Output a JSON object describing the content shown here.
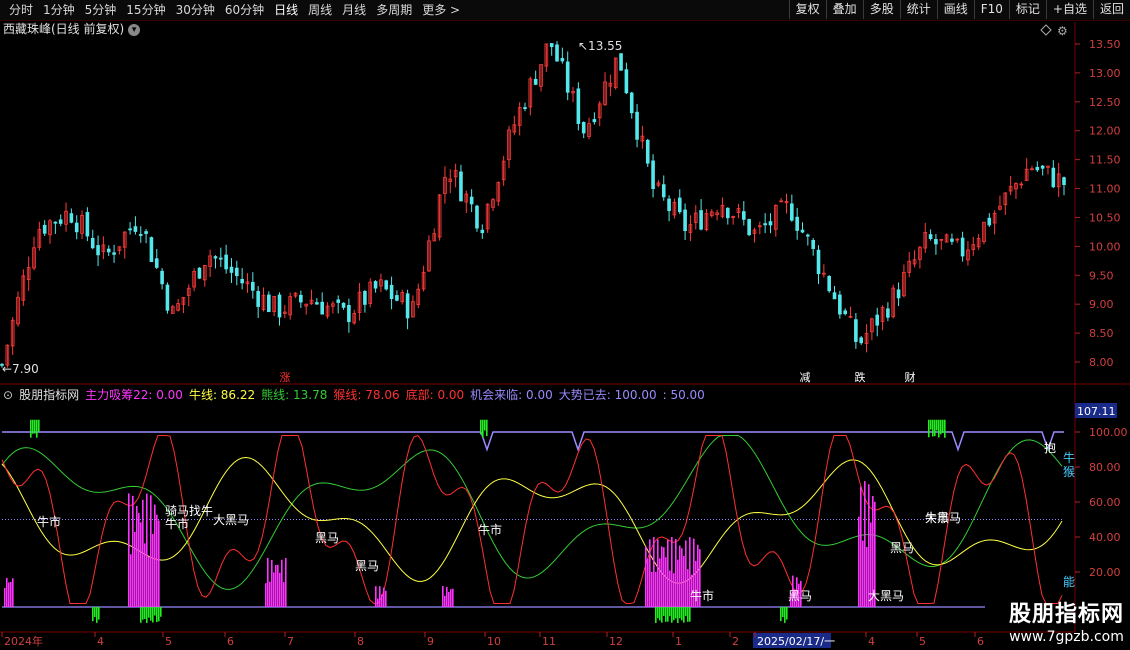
{
  "toolbar": {
    "periods": [
      "分时",
      "1分钟",
      "5分钟",
      "15分钟",
      "30分钟",
      "60分钟",
      "日线",
      "周线",
      "月线",
      "多周期",
      "更多 >"
    ],
    "active_period": "日线",
    "tools": [
      "复权",
      "叠加",
      "多股",
      "统计",
      "画线",
      "F10",
      "标记",
      "+自选",
      "返回"
    ]
  },
  "stock": {
    "title": "西藏珠峰(日线 前复权)"
  },
  "price_axis": {
    "ticks": [
      "13.55",
      "13.00",
      "12.50",
      "12.00",
      "11.50",
      "11.00",
      "10.50",
      "10.00",
      "9.50",
      "9.00",
      "8.50",
      "8.00"
    ]
  },
  "price_marks": {
    "high": "13.55",
    "low": "←7.90"
  },
  "event_markers": [
    {
      "text": "涨",
      "color": "#ff3030"
    },
    {
      "text": "减",
      "color": "#ffffff"
    },
    {
      "text": "跌",
      "color": "#ffffff"
    },
    {
      "text": "财",
      "color": "#ffffff"
    }
  ],
  "indicator": {
    "name": "股朋指标网",
    "items": [
      {
        "label": "主力吸筹22: 0.00",
        "color": "#ff33ff"
      },
      {
        "label": "牛线: 86.22",
        "color": "#ffff44"
      },
      {
        "label": "熊线: 13.78",
        "color": "#33cc33"
      },
      {
        "label": "猴线: 78.06",
        "color": "#ff3030"
      },
      {
        "label": "底部: 0.00",
        "color": "#ff3030"
      },
      {
        "label": "机会来临: 0.00",
        "color": "#9a8aff"
      },
      {
        "label": "大势已去: 100.00",
        "color": "#9a8aff"
      },
      {
        "label": ": 50.00",
        "color": "#9a8aff"
      }
    ],
    "axis_ticks": [
      "100.00",
      "80.00",
      "60.00",
      "40.00",
      "20.00"
    ],
    "current_value": "107.11",
    "right_labels": [
      "牛",
      "猴",
      "能"
    ],
    "chart_labels": [
      "牛市",
      "骑马找牛",
      "牛市",
      "黑马",
      "牛市",
      "黑马",
      "黑马",
      "牛市",
      "大黑马",
      "黑马",
      "大黑马",
      "大黑马",
      "牛市",
      "抱"
    ]
  },
  "date_axis": {
    "ticks": [
      "2024年",
      "4",
      "5",
      "6",
      "7",
      "8",
      "9",
      "10",
      "11",
      "12",
      "1",
      "2",
      "2025/02/17/一",
      "4",
      "5",
      "6"
    ]
  },
  "watermark": {
    "title": "股朋指标网",
    "url": "www.7gpzb.com"
  },
  "chart_data": {
    "type": "candlestick",
    "title": "西藏珠峰(日线 前复权)",
    "x_range": [
      "2024-03",
      "2025-06"
    ],
    "ylim": [
      7.9,
      13.55
    ],
    "y_ticks": [
      8.0,
      8.5,
      9.0,
      9.5,
      10.0,
      10.5,
      11.0,
      11.5,
      12.0,
      12.5,
      13.0,
      13.5
    ],
    "high": 13.55,
    "low": 7.9,
    "approx_close_path": [
      [
        "2024-03",
        7.95
      ],
      [
        "2024-03",
        10.3
      ],
      [
        "2024-04",
        10.6
      ],
      [
        "2024-04",
        9.8
      ],
      [
        "2024-05",
        10.5
      ],
      [
        "2024-05",
        8.8
      ],
      [
        "2024-06",
        9.9
      ],
      [
        "2024-06",
        9.4
      ],
      [
        "2024-07",
        8.9
      ],
      [
        "2024-08",
        9.1
      ],
      [
        "2024-08",
        8.8
      ],
      [
        "2024-09",
        9.3
      ],
      [
        "2024-09",
        8.9
      ],
      [
        "2024-10",
        11.4
      ],
      [
        "2024-10",
        10.4
      ],
      [
        "2024-11",
        12.2
      ],
      [
        "2024-11",
        13.55
      ],
      [
        "2024-12",
        12.0
      ],
      [
        "2024-12",
        13.3
      ],
      [
        "2025-01",
        11.0
      ],
      [
        "2025-01",
        10.3
      ],
      [
        "2025-02",
        10.8
      ],
      [
        "2025-02",
        10.2
      ],
      [
        "2025-03",
        10.7
      ],
      [
        "2025-04",
        9.5
      ],
      [
        "2025-04",
        8.3
      ],
      [
        "2025-04",
        9.1
      ],
      [
        "2025-05",
        10.1
      ],
      [
        "2025-05",
        9.9
      ],
      [
        "2025-06",
        10.6
      ],
      [
        "2025-06",
        11.4
      ],
      [
        "2025-06",
        11.1
      ]
    ],
    "indicator_series": [
      {
        "name": "主力吸筹22",
        "last": 0.0
      },
      {
        "name": "牛线",
        "last": 86.22
      },
      {
        "name": "熊线",
        "last": 13.78
      },
      {
        "name": "猴线",
        "last": 78.06
      },
      {
        "name": "底部",
        "last": 0.0
      },
      {
        "name": "机会来临",
        "last": 0.0
      },
      {
        "name": "大势已去",
        "last": 100.0
      },
      {
        "name": "",
        "last": 50.0
      }
    ],
    "indicator_ylim": [
      0,
      107.11
    ]
  }
}
